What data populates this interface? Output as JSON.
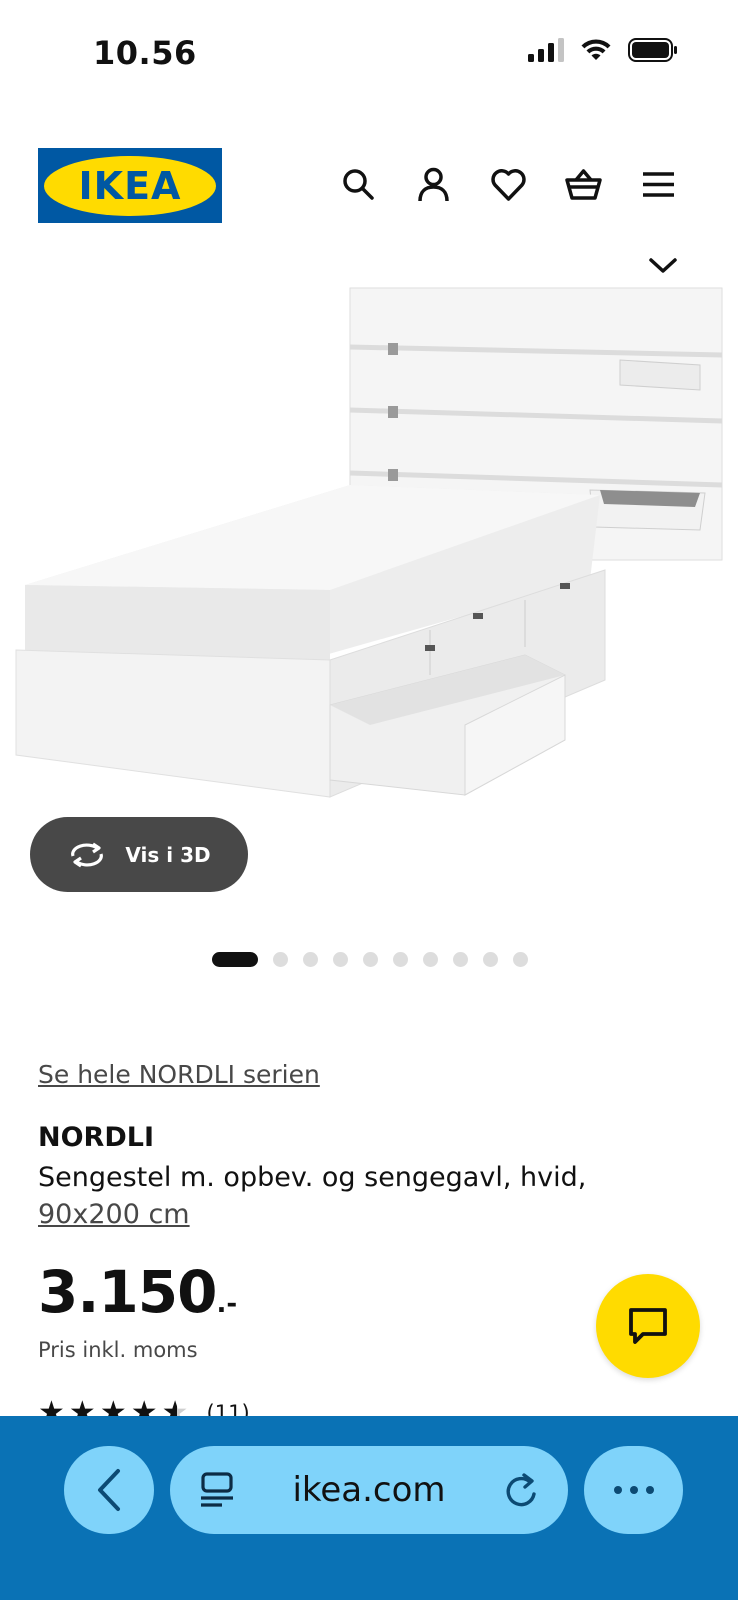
{
  "status": {
    "time": "10.56"
  },
  "header": {
    "logo_text": "IKEA",
    "icons": [
      "search-icon",
      "account-icon",
      "heart-icon",
      "basket-icon",
      "menu-icon"
    ]
  },
  "gallery": {
    "view_3d_label": "Vis i 3D",
    "image_count": 10,
    "active_index": 0
  },
  "product": {
    "series_link": "Se hele NORDLI serien",
    "name": "NORDLI",
    "description": "Sengestel m. opbev. og sengegavl, hvid,",
    "size": "90x200 cm",
    "price_main": "3.150",
    "price_suffix": ".-",
    "price_note": "Pris inkl. moms",
    "rating_value": 4.5,
    "rating_count": "(11)"
  },
  "browser": {
    "url": "ikea.com"
  },
  "colors": {
    "ikea_blue": "#0058a3",
    "ikea_yellow": "#ffdb00",
    "browser_bar": "#0a72b5",
    "browser_pill": "#7fd3fa"
  }
}
